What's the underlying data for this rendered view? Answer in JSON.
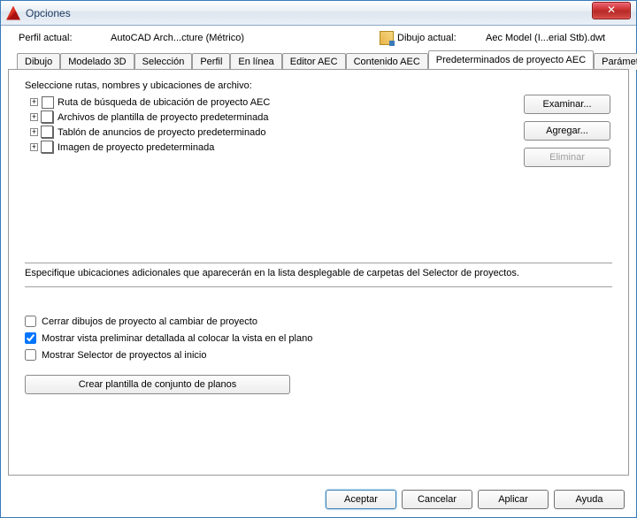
{
  "window": {
    "title": "Opciones",
    "close": "✕"
  },
  "header": {
    "profile_label": "Perfil actual:",
    "profile_value": "AutoCAD Arch...cture (Métrico)",
    "drawing_label": "Dibujo actual:",
    "drawing_value": "Aec Model (I...erial Stb).dwt"
  },
  "tabs": {
    "list": [
      "Dibujo",
      "Modelado 3D",
      "Selección",
      "Perfil",
      "En línea",
      "Editor AEC",
      "Contenido AEC",
      "Predeterminados de proyecto AEC",
      "Parámetros d"
    ],
    "active_index": 7,
    "nav_left": "◄",
    "nav_right": "►"
  },
  "tree": {
    "label": "Seleccione rutas, nombres y ubicaciones de archivo:",
    "items": [
      "Ruta de búsqueda de ubicación de proyecto AEC",
      "Archivos de plantilla de proyecto predeterminada",
      "Tablón de anuncios de proyecto predeterminado",
      "Imagen de proyecto predeterminada"
    ]
  },
  "buttons": {
    "browse": "Examinar...",
    "add": "Agregar...",
    "delete": "Eliminar"
  },
  "description": "Especifique ubicaciones adicionales que aparecerán en la lista desplegable de carpetas del Selector de proyectos.",
  "checkboxes": {
    "close": "Cerrar dibujos de proyecto al cambiar de proyecto",
    "preview": "Mostrar vista preliminar detallada al colocar la vista en el plano",
    "selector": "Mostrar Selector de proyectos al inicio",
    "preview_checked": true
  },
  "create_template": "Crear plantilla de conjunto de planos",
  "footer": {
    "ok": "Aceptar",
    "cancel": "Cancelar",
    "apply": "Aplicar",
    "help": "Ayuda"
  }
}
